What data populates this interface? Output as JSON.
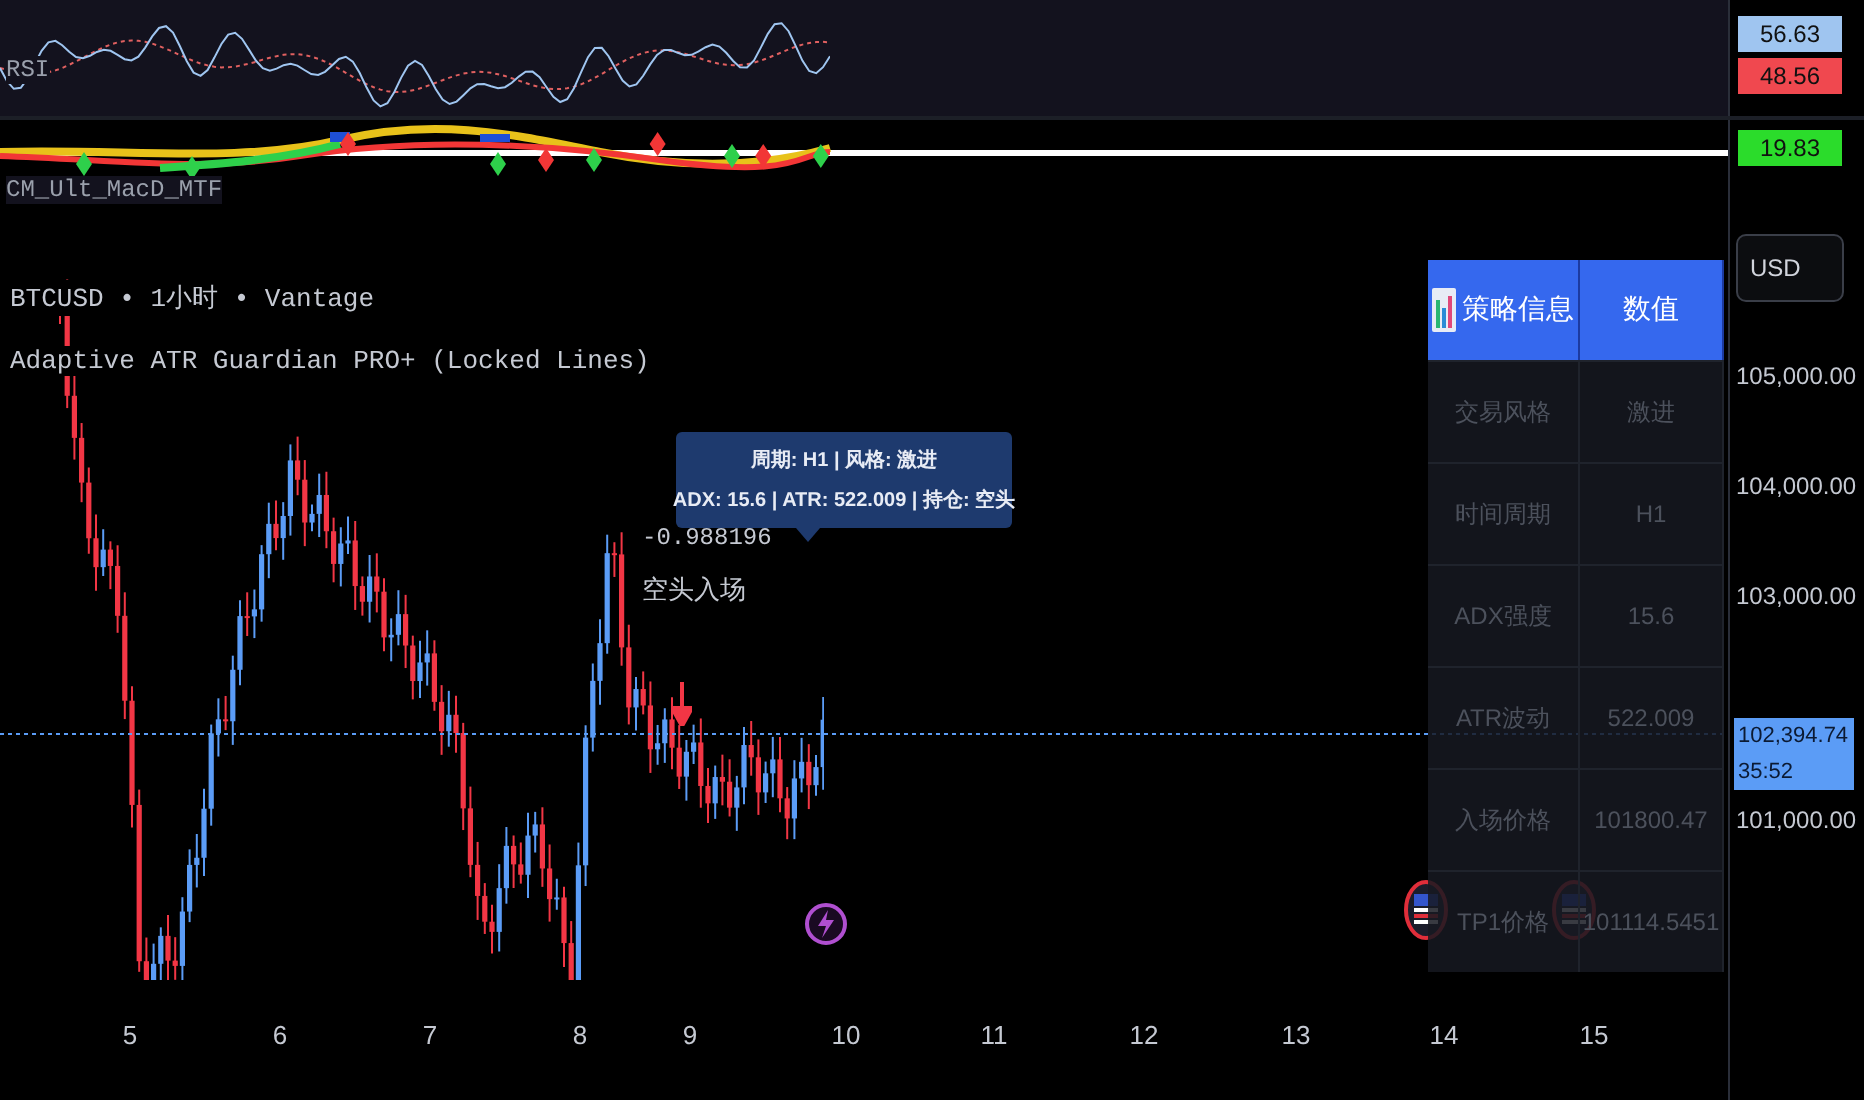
{
  "rsi_pane": {
    "label": "RSI",
    "scale_labels": [
      {
        "text": "56.63",
        "color": "#9fc5f0"
      },
      {
        "text": "48.56",
        "color": "#f0484f"
      }
    ]
  },
  "macd_pane": {
    "label": "CM_Ult_MacD_MTF",
    "scale_label": "19.83"
  },
  "legend": {
    "symbol_line": "BTCUSD • 1小时 • Vantage",
    "indicator_line": "Adaptive ATR Guardian PRO+ (Locked Lines)"
  },
  "currency_button": "USD",
  "price_axis": [
    "105,000.00",
    "104,000.00",
    "103,000.00",
    "101,000.00"
  ],
  "current_price": {
    "price": "102,394.74",
    "countdown": "35:52"
  },
  "signal_label": {
    "value": "-0.988196",
    "text": "空头入场"
  },
  "tooltip": {
    "lines": [
      "周期: H1 | 风格: 激进",
      "ADX: 15.6 | ATR: 522.009 | 持仓: 空头"
    ]
  },
  "info_table": {
    "columns": [
      "策略信息",
      "数值"
    ],
    "rows": [
      {
        "label": "交易风格",
        "value": "激进"
      },
      {
        "label": "时间周期",
        "value": "H1"
      },
      {
        "label": "ADX强度",
        "value": "15.6"
      },
      {
        "label": "ATR波动",
        "value": "522.009"
      },
      {
        "label": "入场价格",
        "value": "101800.47"
      },
      {
        "label": "TP1价格",
        "value": "101114.5451"
      }
    ]
  },
  "time_axis": [
    "5",
    "6",
    "7",
    "8",
    "9",
    "10",
    "11",
    "12",
    "13",
    "14",
    "15"
  ]
}
